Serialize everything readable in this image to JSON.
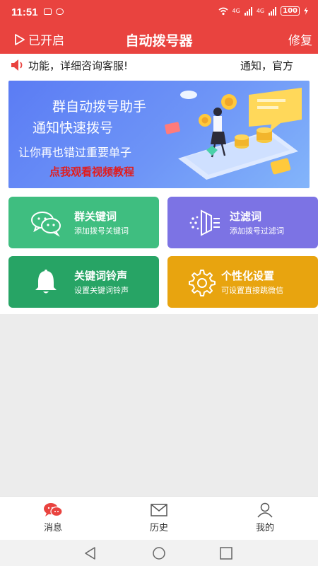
{
  "status_bar": {
    "time": "11:51",
    "network_left": "4G",
    "network_right": "4G",
    "battery": "100"
  },
  "header": {
    "left_label": "已开启",
    "title": "自动拨号器",
    "right_label": "修复"
  },
  "notice": {
    "text_scroll": "功能，详细咨询客服!",
    "text_next": "通知，官方"
  },
  "banner": {
    "line1": "群自动拨号助手",
    "line2": "通知快速拨号",
    "line3": "让你再也错过重要单子",
    "cta": "点我观看视频教程"
  },
  "cards": [
    {
      "title": "群关键词",
      "subtitle": "添加拨号关键词",
      "icon": "wechat-icon",
      "color": "#3fbe80"
    },
    {
      "title": "过滤词",
      "subtitle": "添加拨号过滤词",
      "icon": "filter-icon",
      "color": "#7c73e4"
    },
    {
      "title": "关键词铃声",
      "subtitle": "设置关键词铃声",
      "icon": "bell-icon",
      "color": "#27a465"
    },
    {
      "title": "个性化设置",
      "subtitle": "可设置直接跳微信",
      "icon": "gear-icon",
      "color": "#e8a40f"
    }
  ],
  "bottom_nav": [
    {
      "label": "消息",
      "icon": "chat-icon",
      "active": true
    },
    {
      "label": "历史",
      "icon": "mail-icon",
      "active": false
    },
    {
      "label": "我的",
      "icon": "user-icon",
      "active": false
    }
  ],
  "colors": {
    "brand": "#e9433f"
  }
}
